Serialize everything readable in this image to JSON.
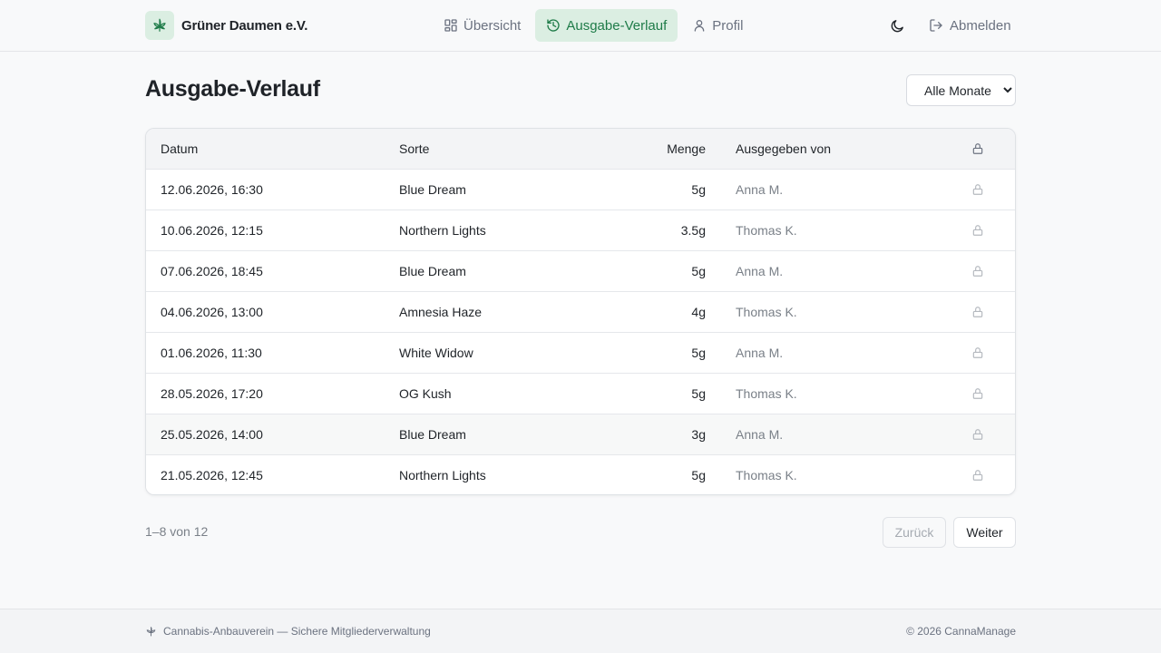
{
  "brand": {
    "name": "Grüner Daumen e.V.",
    "logo_icon": "cannabis-leaf-icon"
  },
  "nav": {
    "items": [
      {
        "label": "Übersicht",
        "icon": "grid-icon",
        "active": false
      },
      {
        "label": "Ausgabe-Verlauf",
        "icon": "history-icon",
        "active": true
      },
      {
        "label": "Profil",
        "icon": "user-icon",
        "active": false
      }
    ],
    "theme_icon": "moon-icon",
    "logout_label": "Abmelden",
    "logout_icon": "logout-icon"
  },
  "page": {
    "title": "Ausgabe-Verlauf",
    "month_filter": {
      "selected": "Alle Monate"
    }
  },
  "table": {
    "columns": {
      "date": "Datum",
      "strain": "Sorte",
      "amount": "Menge",
      "issued_by": "Ausgegeben von",
      "lock_icon": "lock-icon"
    },
    "rows": [
      {
        "date": "12.06.2026, 16:30",
        "strain": "Blue Dream",
        "amount": "5g",
        "issued_by": "Anna M."
      },
      {
        "date": "10.06.2026, 12:15",
        "strain": "Northern Lights",
        "amount": "3.5g",
        "issued_by": "Thomas K."
      },
      {
        "date": "07.06.2026, 18:45",
        "strain": "Blue Dream",
        "amount": "5g",
        "issued_by": "Anna M."
      },
      {
        "date": "04.06.2026, 13:00",
        "strain": "Amnesia Haze",
        "amount": "4g",
        "issued_by": "Thomas K."
      },
      {
        "date": "01.06.2026, 11:30",
        "strain": "White Widow",
        "amount": "5g",
        "issued_by": "Anna M."
      },
      {
        "date": "28.05.2026, 17:20",
        "strain": "OG Kush",
        "amount": "5g",
        "issued_by": "Thomas K."
      },
      {
        "date": "25.05.2026, 14:00",
        "strain": "Blue Dream",
        "amount": "3g",
        "issued_by": "Anna M."
      },
      {
        "date": "21.05.2026, 12:45",
        "strain": "Northern Lights",
        "amount": "5g",
        "issued_by": "Thomas K."
      }
    ]
  },
  "pagination": {
    "info": "1–8 von 12",
    "prev_label": "Zurück",
    "next_label": "Weiter"
  },
  "footer": {
    "left_text": "Cannabis-Anbauverein — Sichere Mitgliederverwaltung",
    "right_text": "© 2026 CannaManage"
  },
  "colors": {
    "accent": "#1e7b48",
    "accent_bg": "#dbeee2",
    "muted": "#6b7280",
    "page_bg": "#f8f9fa"
  }
}
